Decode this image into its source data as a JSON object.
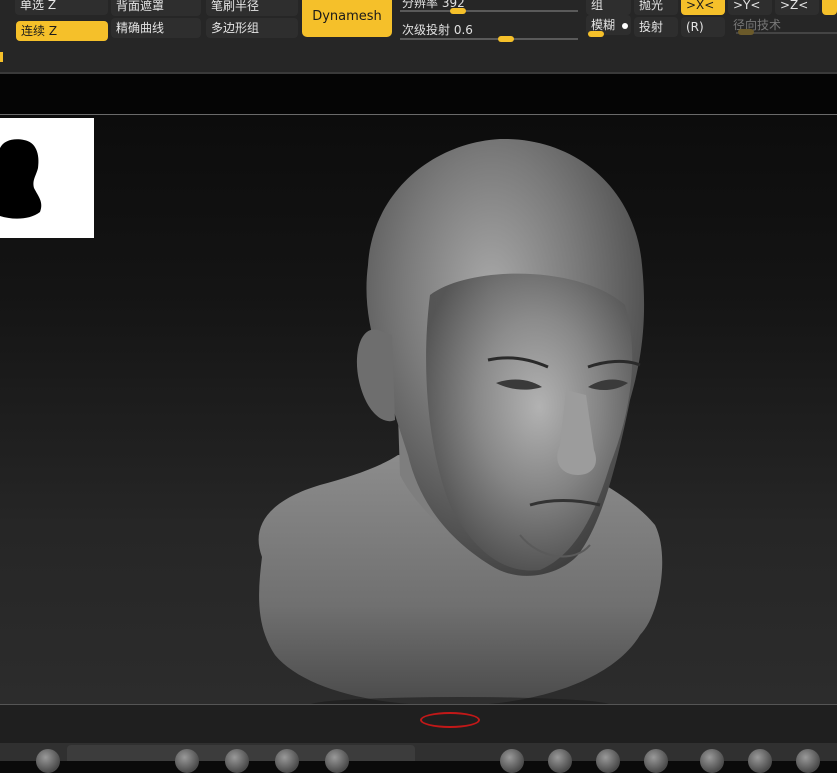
{
  "palette": {
    "col1": {
      "single_z": "单选 Z",
      "continuous_z": "连续 Z"
    },
    "col2": {
      "backface_mask": "背面遮罩",
      "precise_curve": "精确曲线"
    },
    "col3": {
      "brush_radius": "笔刷半径",
      "polygroup": "多边形组"
    },
    "dynamesh_label": "Dynamesh",
    "resolution": {
      "label": "分辨率 392"
    },
    "subdiv_project": {
      "label": "次级投射 0.6"
    },
    "group_label": "组",
    "blur_label": "模糊",
    "polish_label": "抛光",
    "project_label": "投射",
    "sym_x": ">X<",
    "sym_y": ">Y<",
    "sym_z": ">Z<",
    "sym_r": "(R)",
    "radial_label": "径向技术"
  },
  "colors": {
    "accent": "#f5c02a",
    "panel_bg": "#262626",
    "annotation_red": "#c21818"
  }
}
